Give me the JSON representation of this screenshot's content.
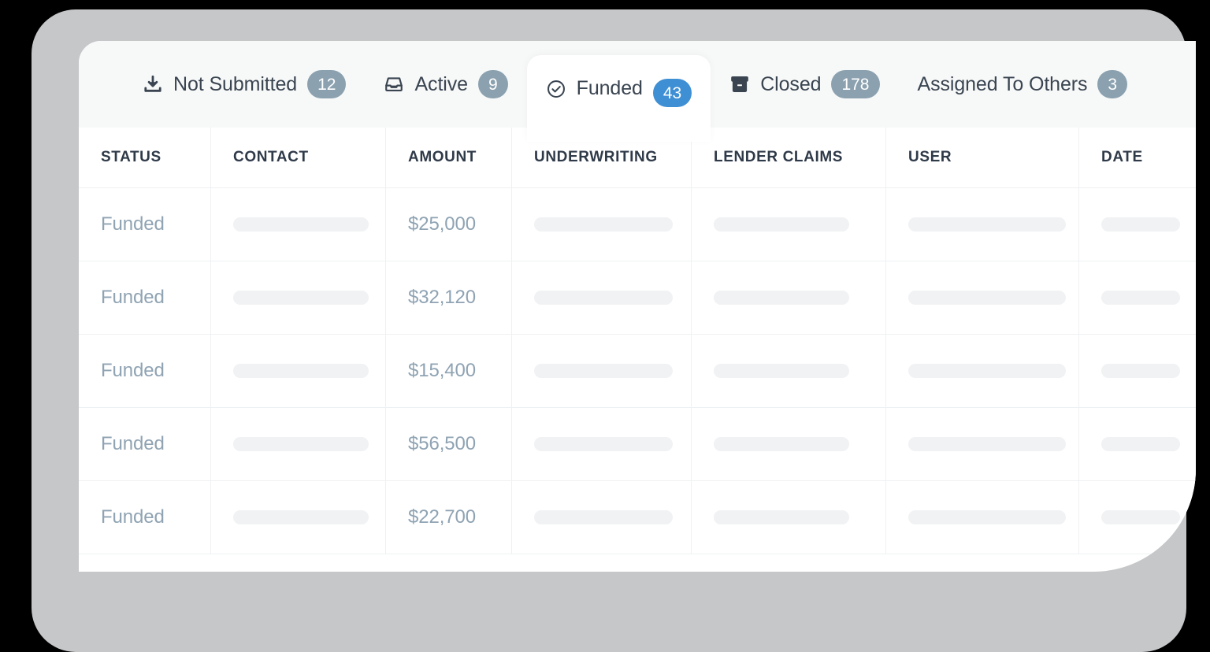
{
  "theme": {
    "bezel_color": "#c6c7c9",
    "panel_background": "#ffffff",
    "tabbar_background": "#f7f8f8",
    "accent_color": "#3f8fd4",
    "badge_color": "#8ba1af",
    "muted_text_color": "#8fa3b3",
    "heading_text_color": "#2f3a49",
    "divider_color": "#eef1f4",
    "skeleton_color": "#f1f2f4"
  },
  "tabs": [
    {
      "id": "not-submitted",
      "label": "Not Submitted",
      "count": "12",
      "icon": "download-tray-icon",
      "active": false
    },
    {
      "id": "active",
      "label": "Active",
      "count": "9",
      "icon": "inbox-icon",
      "active": false
    },
    {
      "id": "funded",
      "label": "Funded",
      "count": "43",
      "icon": "check-circle-icon",
      "active": true
    },
    {
      "id": "closed",
      "label": "Closed",
      "count": "178",
      "icon": "archive-box-icon",
      "active": false
    },
    {
      "id": "assigned-to-others",
      "label": "Assigned To Others",
      "count": "3",
      "icon": "none",
      "active": false
    }
  ],
  "table": {
    "columns": [
      {
        "key": "status",
        "label": "STATUS"
      },
      {
        "key": "contact",
        "label": "CONTACT"
      },
      {
        "key": "amount",
        "label": "AMOUNT"
      },
      {
        "key": "underwriting",
        "label": "UNDERWRITING"
      },
      {
        "key": "lender",
        "label": "LENDER CLAIMS"
      },
      {
        "key": "user",
        "label": "USER"
      },
      {
        "key": "date",
        "label": "DATE"
      }
    ],
    "rows": [
      {
        "status": "Funded",
        "amount": "$25,000",
        "contact": "",
        "underwriting": "",
        "lender": "",
        "user": "",
        "date": ""
      },
      {
        "status": "Funded",
        "amount": "$32,120",
        "contact": "",
        "underwriting": "",
        "lender": "",
        "user": "",
        "date": ""
      },
      {
        "status": "Funded",
        "amount": "$15,400",
        "contact": "",
        "underwriting": "",
        "lender": "",
        "user": "",
        "date": ""
      },
      {
        "status": "Funded",
        "amount": "$56,500",
        "contact": "",
        "underwriting": "",
        "lender": "",
        "user": "",
        "date": ""
      },
      {
        "status": "Funded",
        "amount": "$22,700",
        "contact": "",
        "underwriting": "",
        "lender": "",
        "user": "",
        "date": ""
      }
    ]
  }
}
